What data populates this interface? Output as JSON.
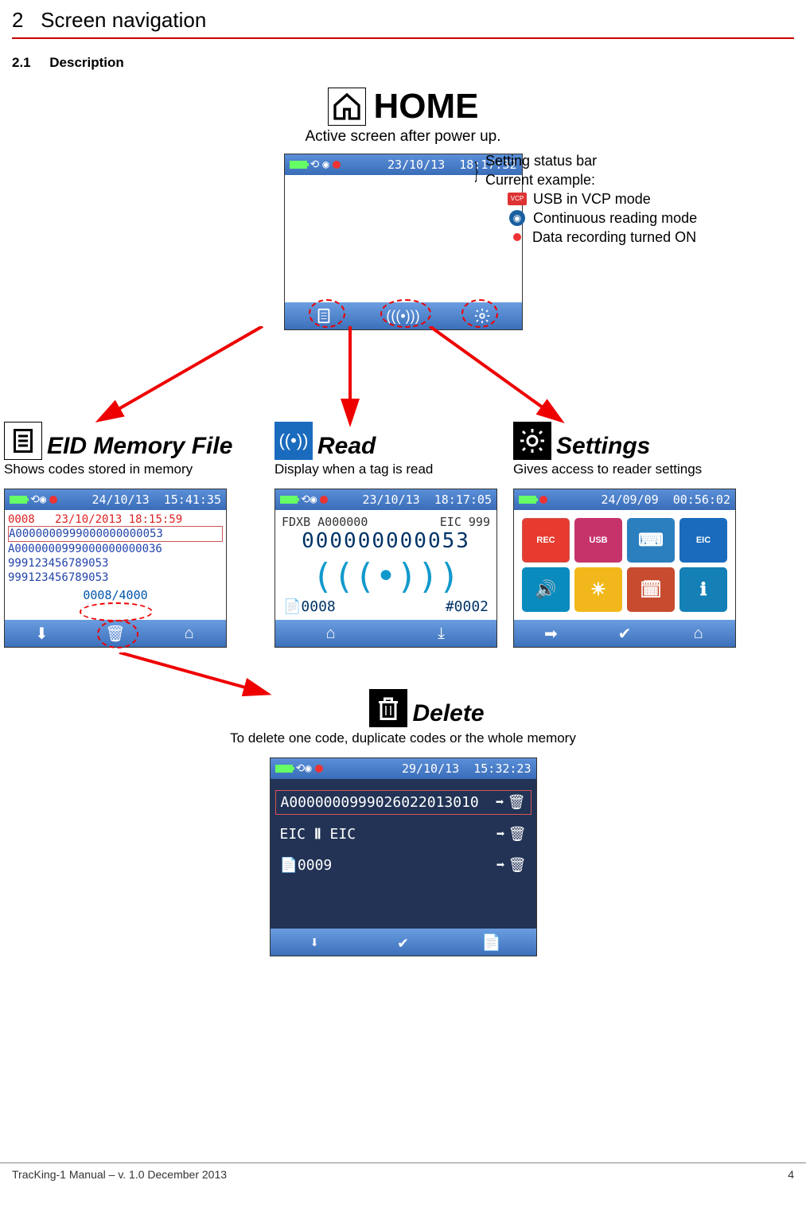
{
  "header": {
    "num": "2",
    "title": "Screen navigation"
  },
  "subheader": {
    "num": "2.1",
    "title": "Description"
  },
  "home": {
    "title": "HOME",
    "icon": "home-icon",
    "subtitle": "Active screen after power up.",
    "status_date": "23/10/13",
    "status_time": "18:17:32"
  },
  "status_annot": {
    "line1": "Setting status bar",
    "line2": "Current example:",
    "items": [
      {
        "icon": "usb-vcp-icon",
        "text": "USB in VCP mode"
      },
      {
        "icon": "continuous-read-icon",
        "text": "Continuous reading mode"
      },
      {
        "icon": "record-dot-icon",
        "text": "Data recording turned ON"
      }
    ]
  },
  "sections": {
    "eid": {
      "icon": "doc-list-icon",
      "title": "EID Memory File",
      "sub": "Shows codes stored in memory",
      "status_date": "24/10/13",
      "status_time": "15:41:35",
      "row_red_idx": "0008",
      "row_red_date": "23/10/2013  18:15:59",
      "rows": [
        "A0000000999000000000053",
        "A0000000999000000000036",
        "999123456789053",
        "999123456789053"
      ],
      "counter": "0008/4000"
    },
    "read": {
      "icon": "radio-wave-icon",
      "title": "Read",
      "sub": "Display when a tag is read",
      "status_date": "23/10/13",
      "status_time": "18:17:05",
      "line1_left": "FDXB A000000",
      "line1_right": "EIC 999",
      "num": "000000000053",
      "bl_left": "0008",
      "bl_right": "#0002"
    },
    "settings": {
      "icon": "gear-icon",
      "title": "Settings",
      "sub": "Gives access to reader settings",
      "status_date": "24/09/09",
      "status_time": "00:56:02",
      "tiles": [
        {
          "color": "#e63b2e",
          "label": "REC"
        },
        {
          "color": "#c6336b",
          "label": "USB"
        },
        {
          "color": "#2c7fbf",
          "label": "⌨"
        },
        {
          "color": "#1a6bbd",
          "label": "EIC"
        },
        {
          "color": "#0a8bbd",
          "label": "🔊"
        },
        {
          "color": "#f2b81b",
          "label": "☀"
        },
        {
          "color": "#c94b2f",
          "label": "🗓"
        },
        {
          "color": "#1480b5",
          "label": "ℹ"
        }
      ]
    }
  },
  "delete": {
    "icon": "trash-icon",
    "title": "Delete",
    "sub": "To delete one code, duplicate codes or the whole memory",
    "status_date": "29/10/13",
    "status_time": "15:32:23",
    "rows": [
      {
        "text": "A0000000999026022013010",
        "show_arrow": true
      },
      {
        "text": "EIC ⇄ EIC",
        "show_arrow": true,
        "icons": true
      },
      {
        "text": "📄 0009",
        "show_arrow": true
      }
    ]
  },
  "footer": {
    "left": "TracKing-1 Manual – v. 1.0 December 2013",
    "right": "4"
  }
}
